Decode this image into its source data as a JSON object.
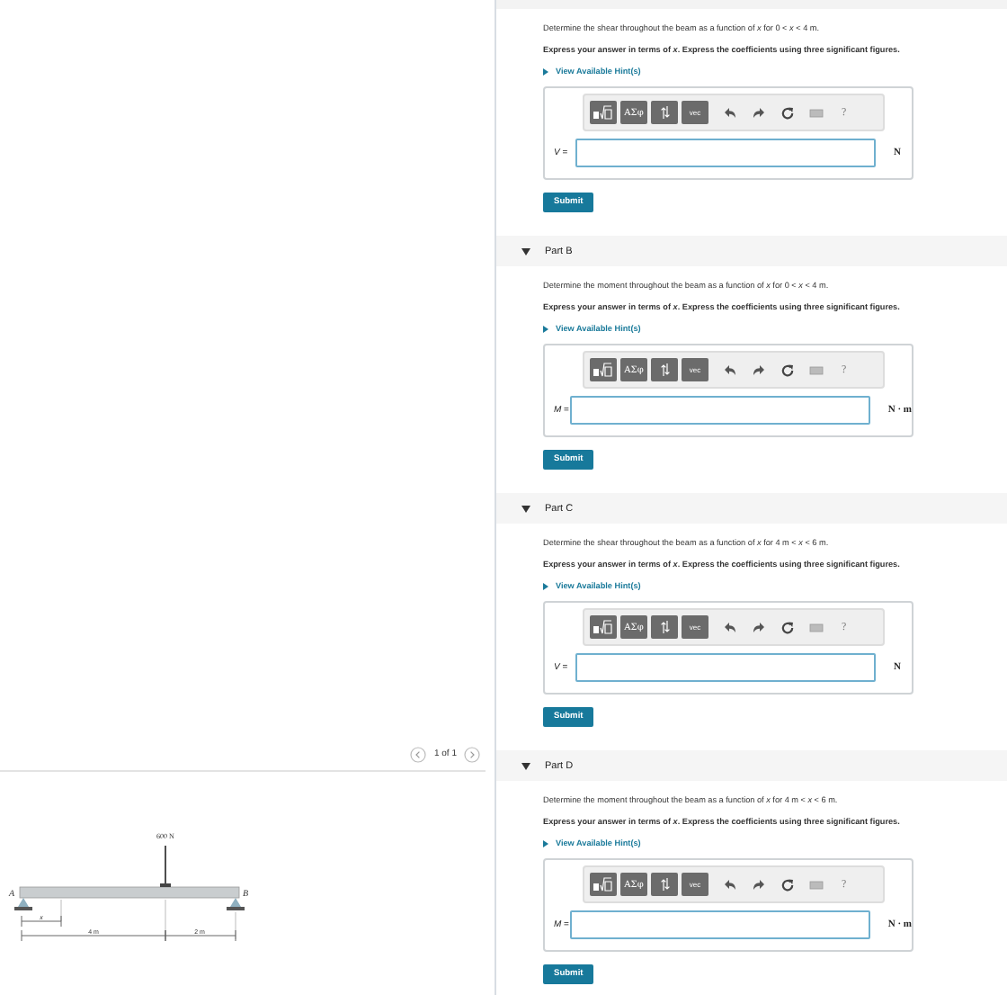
{
  "figure": {
    "pager": {
      "label": "1 of 1"
    },
    "load_label": "600 N",
    "support_labels": [
      "A",
      "B"
    ],
    "dimension_labels": [
      "x",
      "4 m",
      "2 m"
    ]
  },
  "parts": [
    {
      "question": "Determine the shear throughout the beam as a function of *x* for 0 < *x* < 4 m.",
      "instruction": "Express your answer in terms of *x*. Express the coefficients using three significant figures.",
      "hint_link": "View Available Hint(s)",
      "toolbar": {
        "symbols": "ΑΣφ",
        "vector": "vec",
        "help": "?"
      },
      "variable": "*V* =",
      "unit": "N",
      "button": "Submit"
    },
    {
      "title": "Part B",
      "expanded": true,
      "question": "Determine the moment throughout the beam as a function of *x* for 0 < *x* < 4 m.",
      "instruction": "Express your answer in terms of *x*. Express the coefficients using three significant figures.",
      "hint_link": "View Available Hint(s)",
      "toolbar": {
        "symbols": "ΑΣφ",
        "vector": "vec",
        "help": "?"
      },
      "variable": "*M* =",
      "unit": "N · m",
      "button": "Submit"
    },
    {
      "title": "Part C",
      "expanded": true,
      "question": "Determine the shear throughout the beam as a function of *x* for 4 m < *x* < 6 m.",
      "instruction": "Express your answer in terms of *x*. Express the coefficients using three significant figures.",
      "hint_link": "View Available Hint(s)",
      "toolbar": {
        "symbols": "ΑΣφ",
        "vector": "vec",
        "help": "?"
      },
      "variable": "*V* =",
      "unit": "N",
      "button": "Submit"
    },
    {
      "title": "Part D",
      "expanded": true,
      "question": "Determine the moment throughout the beam as a function of *x* for 4 m < *x* < 6 m.",
      "instruction": "Express your answer in terms of *x*. Express the coefficients using three significant figures.",
      "hint_link": "View Available Hint(s)",
      "toolbar": {
        "symbols": "ΑΣφ",
        "vector": "vec",
        "help": "?"
      },
      "variable": "*M* =",
      "unit": "N · m",
      "button": "Submit"
    }
  ]
}
